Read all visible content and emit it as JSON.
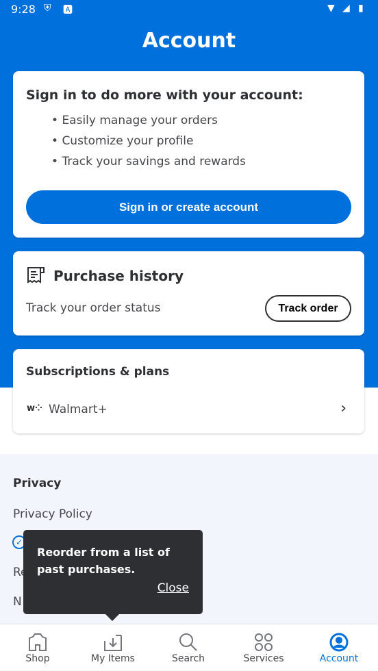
{
  "status_bar": {
    "time": "9:28"
  },
  "header": {
    "title": "Account"
  },
  "signin_card": {
    "heading": "Sign in to do more with your account:",
    "bullets": [
      "Easily manage your orders",
      "Customize your profile",
      "Track your savings and rewards"
    ],
    "button": "Sign in or create account"
  },
  "purchase_card": {
    "heading": "Purchase history",
    "subtitle": "Track your order status",
    "button": "Track order"
  },
  "subscriptions_card": {
    "heading": "Subscriptions & plans",
    "item": "Walmart+"
  },
  "privacy": {
    "heading": "Privacy",
    "items": [
      "Privacy Policy",
      "Re",
      "N"
    ]
  },
  "tooltip": {
    "text": "Reorder from a list of past purchases.",
    "close": "Close"
  },
  "bottom_nav": {
    "items": [
      {
        "label": "Shop",
        "icon": "store-icon"
      },
      {
        "label": "My Items",
        "icon": "download-tray-icon"
      },
      {
        "label": "Search",
        "icon": "search-icon"
      },
      {
        "label": "Services",
        "icon": "grid-circles-icon"
      },
      {
        "label": "Account",
        "icon": "account-icon",
        "active": true
      }
    ]
  },
  "colors": {
    "brand_blue": "#0071dc",
    "text": "#2e2f32"
  }
}
